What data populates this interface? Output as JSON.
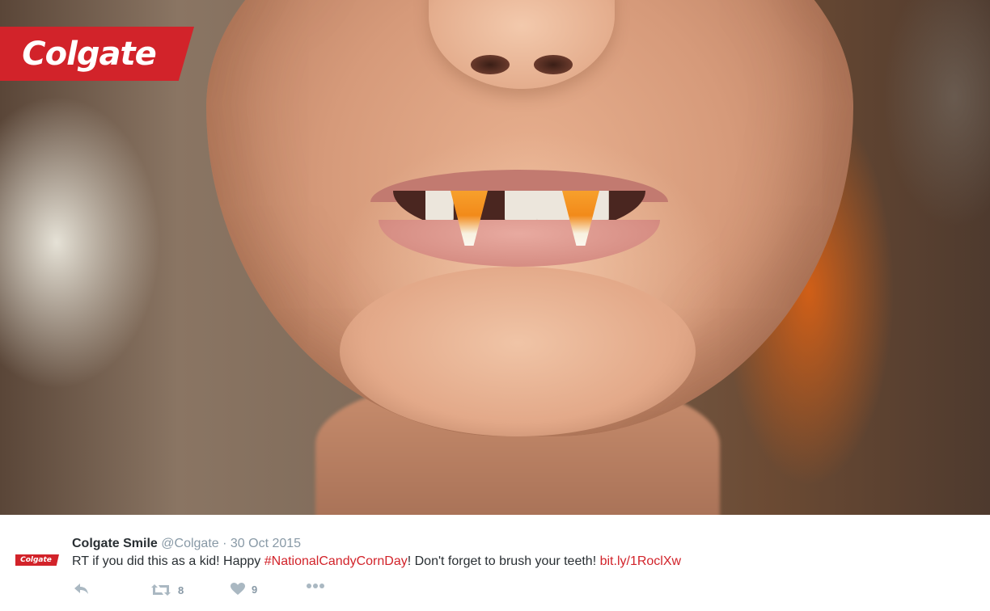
{
  "photo": {
    "logo_text": "Colgate"
  },
  "tweet": {
    "avatar_text": "Colgate",
    "display_name": "Colgate Smile",
    "handle": "@Colgate",
    "separator": "·",
    "date": "30 Oct 2015",
    "text_before": "RT if you did this as a kid! Happy ",
    "hashtag": "#NationalCandyCornDay",
    "text_after": "! Don't forget to brush your teeth! ",
    "link": "bit.ly/1RoclXw",
    "actions": {
      "reply_icon": "reply-icon",
      "retweet_icon": "retweet-icon",
      "retweet_count": "8",
      "like_icon": "heart-icon",
      "like_count": "9",
      "more_icon": "more-icon"
    },
    "colors": {
      "brand_red": "#d2232a",
      "muted": "#8899a6",
      "text": "#292f33"
    }
  }
}
